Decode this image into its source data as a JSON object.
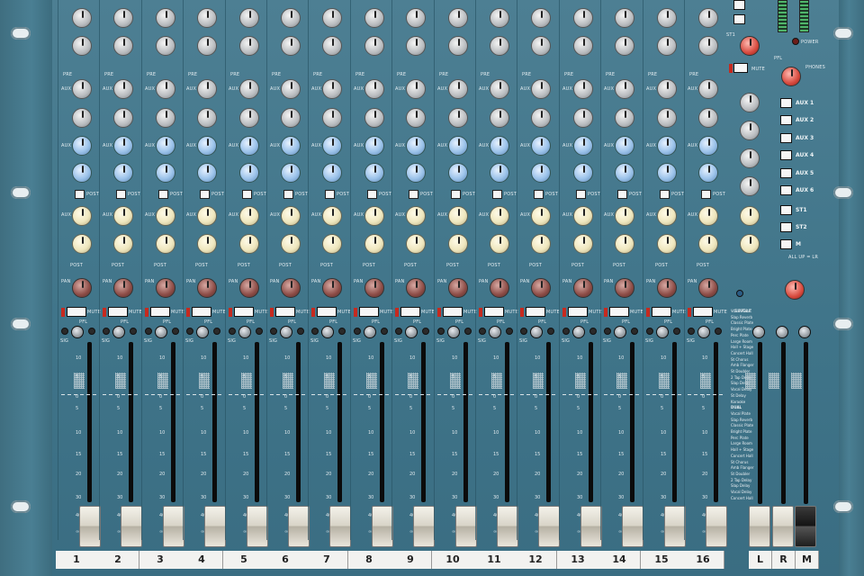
{
  "channels": [
    "1",
    "2",
    "3",
    "4",
    "5",
    "6",
    "7",
    "8",
    "9",
    "10",
    "11",
    "12",
    "13",
    "14",
    "15",
    "16"
  ],
  "strip_labels": {
    "pre": "PRE",
    "aux": "AUX",
    "post": "POST",
    "pan": "PAN",
    "mute": "MUTE",
    "pfl": "PFL",
    "sig": "SIG"
  },
  "fader_scale": [
    "10",
    "5",
    "0",
    "5",
    "10",
    "15",
    "20",
    "30",
    "40",
    "∞"
  ],
  "master": {
    "power": "POWER",
    "pfl": "PFL",
    "phones": "PHONES",
    "st1": "ST1",
    "mute": "MUTE",
    "buttons": [
      "AUX 1",
      "AUX 2",
      "AUX 3",
      "AUX 4",
      "AUX 5",
      "AUX 6",
      "ST1",
      "ST2",
      "M"
    ],
    "all_up": "ALL UP = LR",
    "fx_title": "SINGLE",
    "fx_dual": "DUAL",
    "fx_single_list": [
      "Vocal Plate",
      "Slap Reverb",
      "Classic Plate",
      "Bright Plate",
      "Perc Plate",
      "Large Room",
      "Hall + Stage",
      "Concert Hall",
      "St Chorus",
      "Amb Flanger",
      "St Doubler",
      "2 Tap Delay",
      "Slap Delay",
      "Vocal Delay",
      "St Delay",
      "Karaoke"
    ],
    "fx_dual_list": [
      "Vocal Plate",
      "Slap Reverb",
      "Classic Plate",
      "Bright Plate",
      "Perc Plate",
      "Large Room",
      "Hall + Stage",
      "Concert Hall",
      "St Chorus",
      "Amb Flanger",
      "St Doubler",
      "2 Tap Delay",
      "Slap Delay",
      "Vocal Delay",
      "Concert Hall"
    ],
    "bottom_labels": [
      "L",
      "R",
      "M"
    ]
  }
}
